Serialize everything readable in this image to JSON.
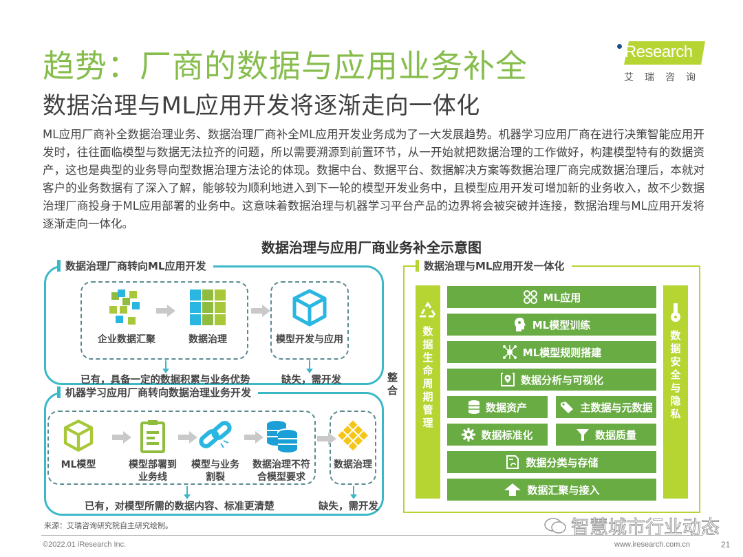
{
  "header": {
    "title": "趋势：厂商的数据与应用业务补全",
    "subtitle": "数据治理与ML应用开发将逐渐走向一体化"
  },
  "logo": {
    "brand": "iResearch",
    "cn": "艾瑞咨询"
  },
  "body_text": "ML应用厂商补全数据治理业务、数据治理厂商补全ML应用开发业务成为了一大发展趋势。机器学习应用厂商在进行决策智能应用开发时，往往面临模型与数据无法拉齐的问题，所以需要溯源到前置环节，从一开始就把数据治理的工作做好，构建模型特有的数据资产，这也是典型的业务导向型数据治理方法论的体现。数据中台、数据平台、数据解决方案等数据治理厂商完成数据治理后，本就对客户的业务数据有了深入了解，能够较为顺利地进入到下一轮的模型开发业务中，且模型应用开发可增加新的业务收入，故不少数据治理厂商投身于ML应用部署的业务中。这意味着数据治理与机器学习平台产品的边界将会被突破并连接，数据治理与ML应用开发将逐渐走向一体化。",
  "diagram": {
    "title": "数据治理与应用厂商业务补全示意图",
    "panel_a": {
      "label": "数据治理厂商转向ML应用开发",
      "nodes": [
        {
          "label": "企业数据汇聚",
          "icon": "scattered-blocks-icon"
        },
        {
          "label": "数据治理",
          "icon": "grid-blocks-icon"
        },
        {
          "label": "模型开发与应用",
          "icon": "cube-icon"
        }
      ],
      "note_have": "已有，具备一定的数据积累与业务优势",
      "note_missing": "缺失，需开发"
    },
    "panel_b": {
      "label": "机器学习应用厂商转向数据治理业务开发",
      "nodes": [
        {
          "label": "ML模型",
          "icon": "cube-icon"
        },
        {
          "label": "模型部署到业务线",
          "line1": "模型部署到",
          "line2": "业务线",
          "icon": "clipboard-icon"
        },
        {
          "label": "模型与业务割裂",
          "line1": "模型与业务",
          "line2": "割裂",
          "icon": "broken-link-icon"
        },
        {
          "label": "数据治理不符合模型要求",
          "line1": "数据治理不符",
          "line2": "合模型要求",
          "icon": "database-icon"
        },
        {
          "label": "数据治理",
          "icon": "diamond-grid-icon"
        }
      ],
      "note_have": "已有，对模型所需的数据内容、标准更清楚",
      "note_missing": "缺失，需开发"
    },
    "merge_label": "整合",
    "panel_right": {
      "label": "数据治理与ML应用开发一体化",
      "left_side": {
        "label": "数据生命周期管理",
        "icon": "recycle-icon"
      },
      "right_side": {
        "label": "数据安全与隐私",
        "icon": "key-icon"
      },
      "layers": [
        {
          "label": "ML应用",
          "icon": "clover-icon"
        },
        {
          "label": "ML模型训练",
          "icon": "brain-head-icon"
        },
        {
          "label": "ML模型规则搭建",
          "icon": "network-icon"
        },
        {
          "label": "数据分析与可视化",
          "icon": "map-pin-icon"
        },
        {
          "label": "数据资产",
          "icon": "database-icon"
        },
        {
          "label": "主数据与元数据",
          "icon": "tag-icon"
        },
        {
          "label": "数据标准化",
          "icon": "gear-icon"
        },
        {
          "label": "数据质量",
          "icon": "funnel-icon"
        },
        {
          "label": "数据分类与存储",
          "icon": "document-sync-icon"
        },
        {
          "label": "数据汇聚与接入",
          "icon": "upload-arrow-icon"
        }
      ]
    },
    "colors": {
      "teal": "#3bb8c8",
      "lime": "#b6d432",
      "green": "#6aac44",
      "title_green": "#86bd4c"
    }
  },
  "source": "来源：艾瑞咨询研究院自主研究绘制。",
  "footer": {
    "copyright": "©2022.01 iResearch Inc.",
    "site": "www.iresearch.com.cn",
    "page": "21"
  },
  "watermark": "智慧城市行业动态"
}
